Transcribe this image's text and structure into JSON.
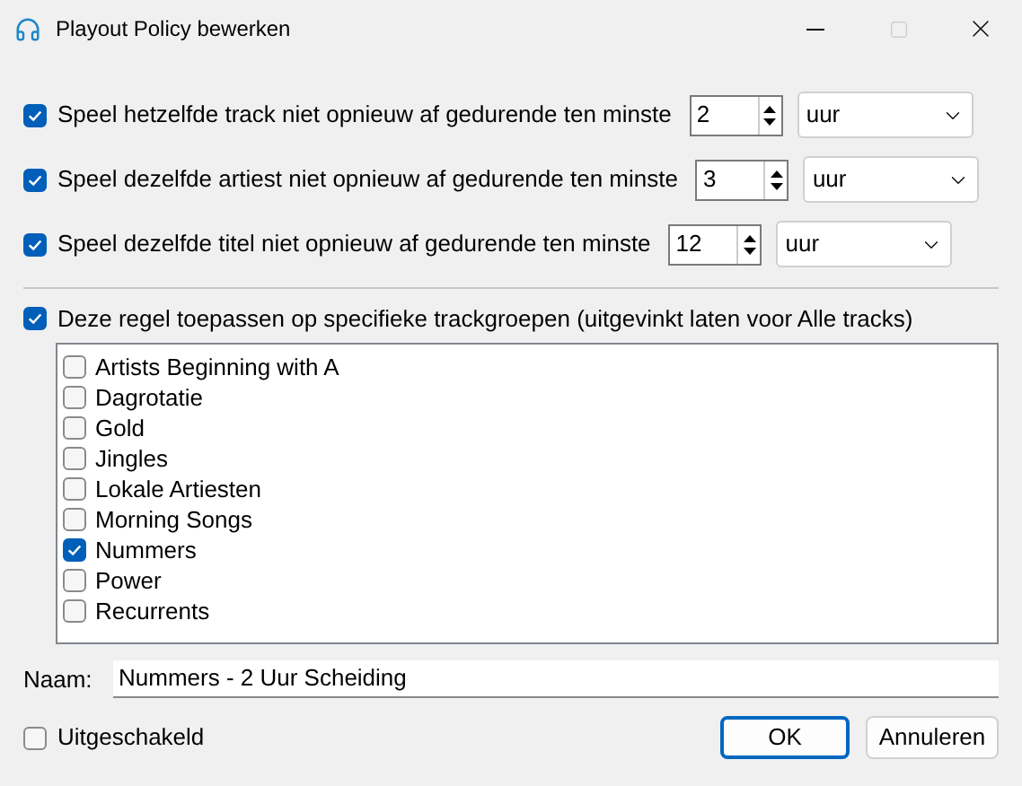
{
  "window": {
    "title": "Playout Policy bewerken"
  },
  "rules": [
    {
      "label": "Speel hetzelfde track niet opnieuw af gedurende ten minste",
      "checked": true,
      "value": "2",
      "unit": "uur"
    },
    {
      "label": "Speel dezelfde artiest niet opnieuw af gedurende ten minste",
      "checked": true,
      "value": "3",
      "unit": "uur"
    },
    {
      "label": "Speel dezelfde titel niet opnieuw af gedurende ten minste",
      "checked": true,
      "value": "12",
      "unit": "uur"
    }
  ],
  "group_filter": {
    "label": "Deze regel toepassen op specifieke trackgroepen (uitgevinkt laten voor Alle tracks)",
    "checked": true
  },
  "groups": [
    {
      "label": "Artists Beginning with A",
      "checked": false
    },
    {
      "label": "Dagrotatie",
      "checked": false
    },
    {
      "label": "Gold",
      "checked": false
    },
    {
      "label": "Jingles",
      "checked": false
    },
    {
      "label": "Lokale Artiesten",
      "checked": false
    },
    {
      "label": "Morning Songs",
      "checked": false
    },
    {
      "label": "Nummers",
      "checked": true
    },
    {
      "label": "Power",
      "checked": false
    },
    {
      "label": "Recurrents",
      "checked": false
    }
  ],
  "name": {
    "label": "Naam:",
    "value": "Nummers - 2 Uur Scheiding"
  },
  "disabled": {
    "label": "Uitgeschakeld",
    "checked": false
  },
  "buttons": [
    {
      "label": "OK",
      "kind": "default"
    },
    {
      "label": "Annuleren",
      "kind": "normal"
    }
  ]
}
